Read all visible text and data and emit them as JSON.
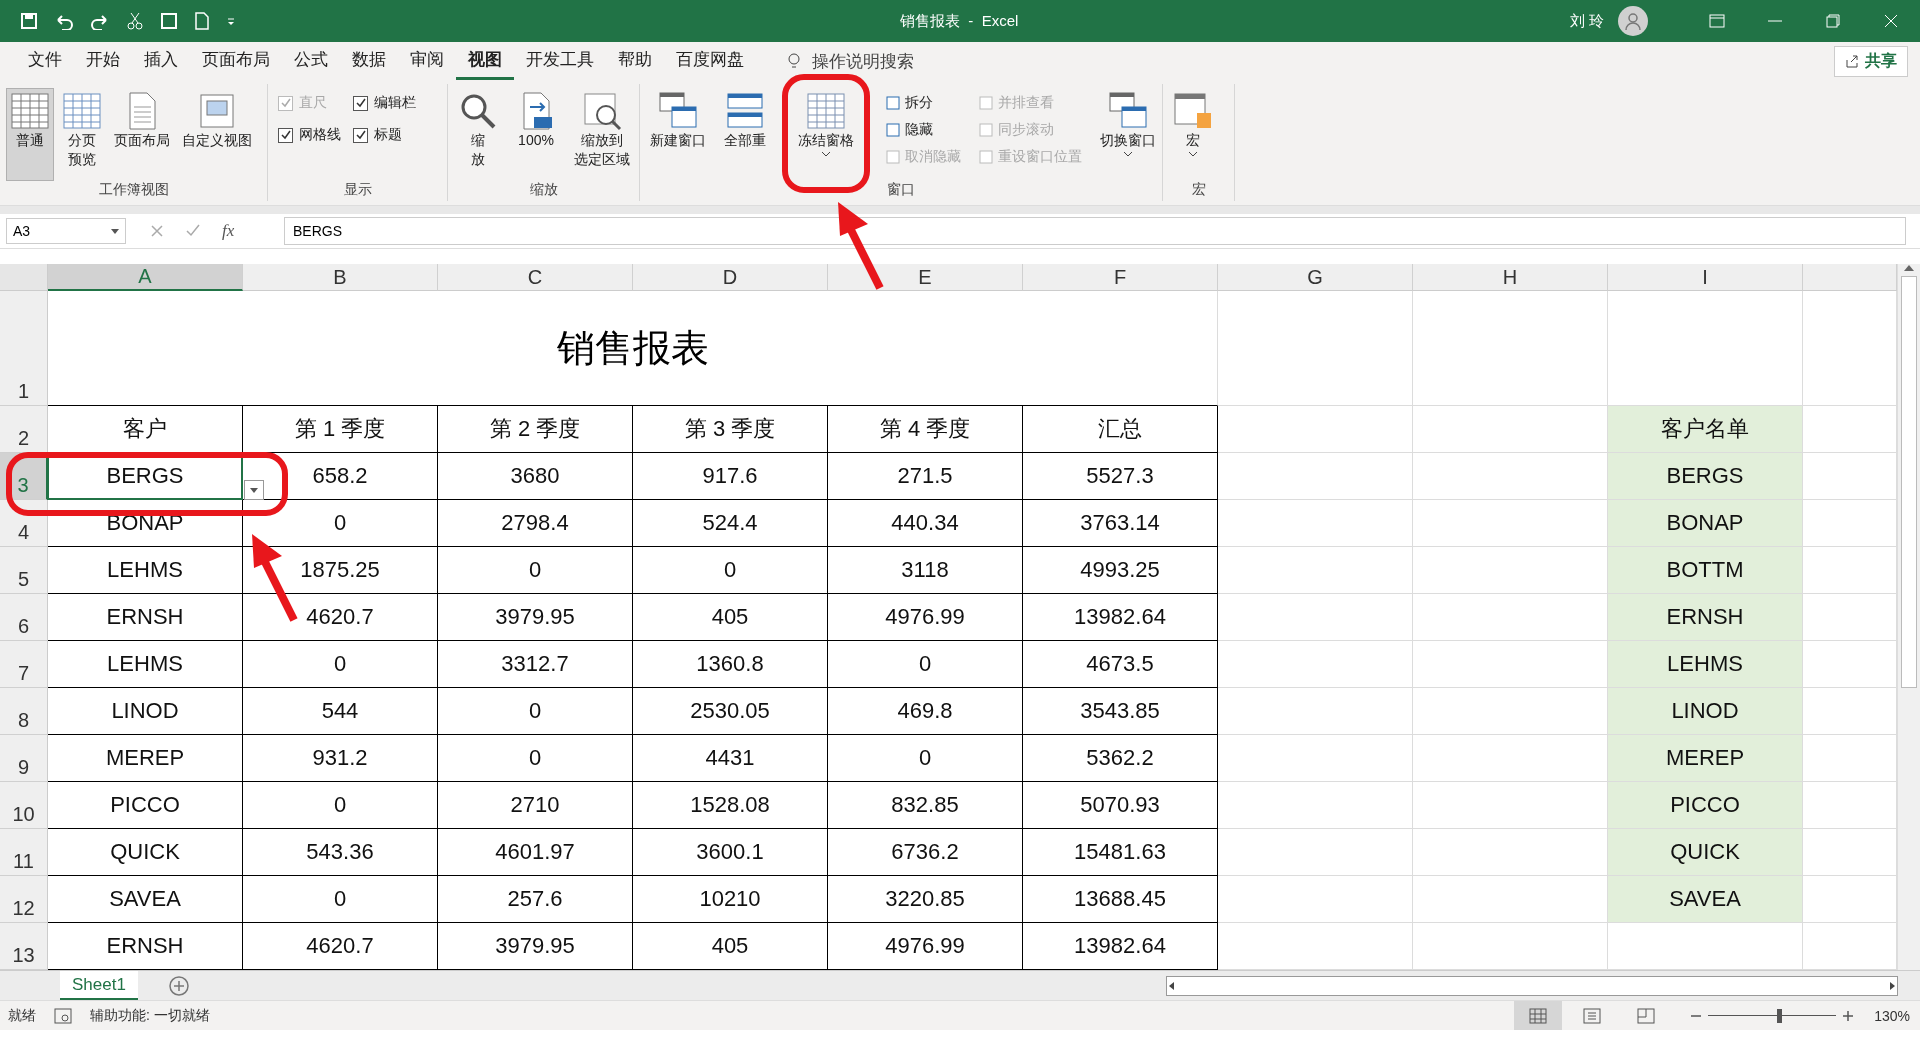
{
  "title_bar": {
    "title": "销售报表  -  Excel",
    "user": "刘 玲"
  },
  "menu_tabs": [
    {
      "label": "文件",
      "selected": false
    },
    {
      "label": "开始",
      "selected": false
    },
    {
      "label": "插入",
      "selected": false
    },
    {
      "label": "页面布局",
      "selected": false
    },
    {
      "label": "公式",
      "selected": false
    },
    {
      "label": "数据",
      "selected": false
    },
    {
      "label": "审阅",
      "selected": false
    },
    {
      "label": "视图",
      "selected": true
    },
    {
      "label": "开发工具",
      "selected": false
    },
    {
      "label": "帮助",
      "selected": false
    },
    {
      "label": "百度网盘",
      "selected": false
    }
  ],
  "search": {
    "placeholder": "操作说明搜索"
  },
  "share_button": "共享",
  "ribbon": {
    "groups": [
      {
        "label": "工作簿视图",
        "items": [
          {
            "kind": "large",
            "label": "普通",
            "selected": true,
            "dropdown": false
          },
          {
            "kind": "large",
            "label": "分页预览",
            "selected": false,
            "dropdown": false
          },
          {
            "kind": "large",
            "label": "页面布局",
            "selected": false,
            "dropdown": false
          },
          {
            "kind": "large",
            "label": "自定义视图",
            "selected": false,
            "dropdown": false
          }
        ]
      },
      {
        "label": "显示",
        "items": [
          {
            "kind": "check",
            "label": "直尺",
            "checked": true,
            "disabled": true
          },
          {
            "kind": "check",
            "label": "网格线",
            "checked": true,
            "disabled": false
          },
          {
            "kind": "check",
            "label": "编辑栏",
            "checked": true,
            "disabled": false
          },
          {
            "kind": "check",
            "label": "标题",
            "checked": true,
            "disabled": false
          }
        ]
      },
      {
        "label": "缩放",
        "items": [
          {
            "kind": "large",
            "label": "缩放",
            "dropdown": false
          },
          {
            "kind": "large",
            "label": "100%",
            "dropdown": false
          },
          {
            "kind": "large",
            "label": "缩放到选定区域",
            "dropdown": false
          }
        ]
      },
      {
        "label": "窗口",
        "items": [
          {
            "kind": "large",
            "label": "新建窗口",
            "dropdown": false
          },
          {
            "kind": "large",
            "label": "全部重",
            "dropdown": false
          },
          {
            "kind": "large",
            "label": "冻结窗格",
            "dropdown": true
          },
          {
            "kind": "small",
            "label": "拆分",
            "disabled": false
          },
          {
            "kind": "small",
            "label": "隐藏",
            "disabled": false
          },
          {
            "kind": "small",
            "label": "取消隐藏",
            "disabled": true
          },
          {
            "kind": "small",
            "label": "并排查看",
            "disabled": true
          },
          {
            "kind": "small",
            "label": "同步滚动",
            "disabled": true
          },
          {
            "kind": "small",
            "label": "重设窗口位置",
            "disabled": true
          },
          {
            "kind": "large",
            "label": "切换窗口",
            "dropdown": true
          }
        ]
      },
      {
        "label": "宏",
        "items": [
          {
            "kind": "large",
            "label": "宏",
            "dropdown": true
          }
        ]
      }
    ]
  },
  "formula_bar": {
    "name_box": "A3",
    "function_label": "fx",
    "value": "BERGS"
  },
  "columns": [
    {
      "label": "A",
      "selected": true
    },
    {
      "label": "B",
      "selected": false
    },
    {
      "label": "C",
      "selected": false
    },
    {
      "label": "D",
      "selected": false
    },
    {
      "label": "E",
      "selected": false
    },
    {
      "label": "F",
      "selected": false
    },
    {
      "label": "G",
      "selected": false
    },
    {
      "label": "H",
      "selected": false
    },
    {
      "label": "I",
      "selected": false
    }
  ],
  "sheet": {
    "title_row": {
      "number": "1",
      "title": "销售报表"
    },
    "header_row": {
      "number": "2",
      "cells": [
        "客户",
        "第 1 季度",
        "第 2 季度",
        "第 3 季度",
        "第 4 季度",
        "汇总"
      ],
      "list_header": "客户名单"
    },
    "rows": [
      {
        "number": "3",
        "selected": true,
        "cells": [
          "BERGS",
          "658.2",
          "3680",
          "917.6",
          "271.5",
          "5527.3"
        ],
        "list_cell": "BERGS"
      },
      {
        "number": "4",
        "selected": false,
        "cells": [
          "BONAP",
          "0",
          "2798.4",
          "524.4",
          "440.34",
          "3763.14"
        ],
        "list_cell": "BONAP"
      },
      {
        "number": "5",
        "selected": false,
        "cells": [
          "LEHMS",
          "1875.25",
          "0",
          "0",
          "3118",
          "4993.25"
        ],
        "list_cell": "BOTTM"
      },
      {
        "number": "6",
        "selected": false,
        "cells": [
          "ERNSH",
          "4620.7",
          "3979.95",
          "405",
          "4976.99",
          "13982.64"
        ],
        "list_cell": "ERNSH"
      },
      {
        "number": "7",
        "selected": false,
        "cells": [
          "LEHMS",
          "0",
          "3312.7",
          "1360.8",
          "0",
          "4673.5"
        ],
        "list_cell": "LEHMS"
      },
      {
        "number": "8",
        "selected": false,
        "cells": [
          "LINOD",
          "544",
          "0",
          "2530.05",
          "469.8",
          "3543.85"
        ],
        "list_cell": "LINOD"
      },
      {
        "number": "9",
        "selected": false,
        "cells": [
          "MEREP",
          "931.2",
          "0",
          "4431",
          "0",
          "5362.2"
        ],
        "list_cell": "MEREP"
      },
      {
        "number": "10",
        "selected": false,
        "cells": [
          "PICCO",
          "0",
          "2710",
          "1528.08",
          "832.85",
          "5070.93"
        ],
        "list_cell": "PICCO"
      },
      {
        "number": "11",
        "selected": false,
        "cells": [
          "QUICK",
          "543.36",
          "4601.97",
          "3600.1",
          "6736.2",
          "15481.63"
        ],
        "list_cell": "QUICK"
      },
      {
        "number": "12",
        "selected": false,
        "cells": [
          "SAVEA",
          "0",
          "257.6",
          "10210",
          "3220.85",
          "13688.45"
        ],
        "list_cell": "SAVEA"
      },
      {
        "number": "13",
        "selected": false,
        "cells": [
          "ERNSH",
          "4620.7",
          "3979.95",
          "405",
          "4976.99",
          "13982.64"
        ]
      }
    ]
  },
  "sheet_tabs": [
    {
      "label": "Sheet1",
      "selected": true
    }
  ],
  "status_bar": {
    "status": "就绪",
    "accessibility": "辅助功能: 一切就绪",
    "views": [
      {
        "selected": true
      },
      {
        "selected": false
      },
      {
        "selected": false
      }
    ],
    "zoom": {
      "level": 0.55,
      "reading": "130%"
    }
  }
}
